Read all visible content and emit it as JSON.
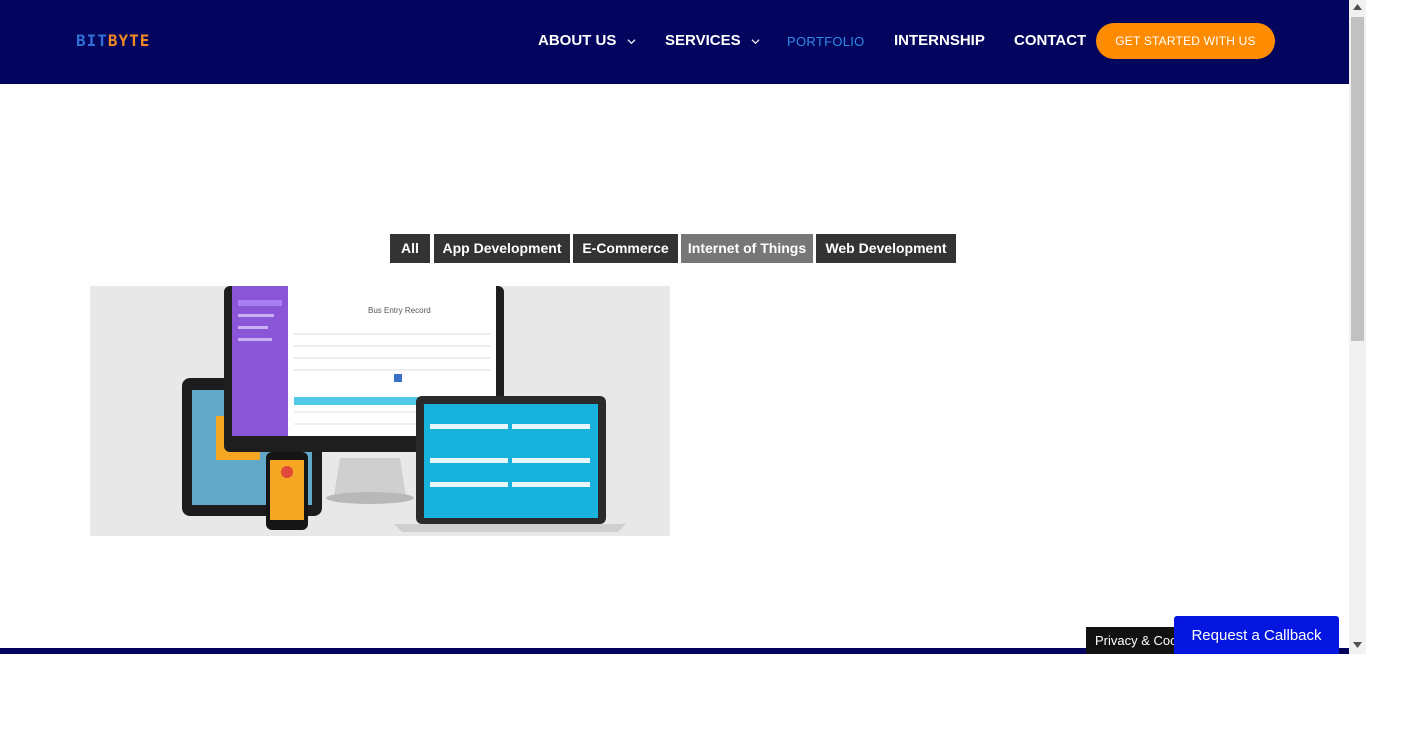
{
  "header": {
    "logo": {
      "part1": "BIT",
      "part2": "BYTE"
    },
    "nav": [
      {
        "label": "ABOUT US",
        "has_dropdown": true
      },
      {
        "label": "SERVICES",
        "has_dropdown": true
      },
      {
        "label": "PORTFOLIO",
        "active": true
      },
      {
        "label": "INTERNSHIP"
      },
      {
        "label": "CONTACT"
      }
    ],
    "cta_label": "GET STARTED WITH US"
  },
  "portfolio": {
    "filters": [
      "All",
      "App Development",
      "E-Commerce",
      "Internet of Things",
      "Web Development"
    ],
    "selected_filter": "Internet of Things",
    "item": {
      "screen_title": "Bus Entry Record"
    }
  },
  "footer": {
    "privacy_label": "Privacy & Cookies Policy",
    "callback_label": "Request a Callback"
  },
  "colors": {
    "header_bg": "#03045e",
    "cta_bg": "#ff8c00",
    "active_nav": "#2f8ce6",
    "filter_bg": "#333333",
    "filter_selected_bg": "#777777",
    "callback_bg": "#0416e0"
  }
}
